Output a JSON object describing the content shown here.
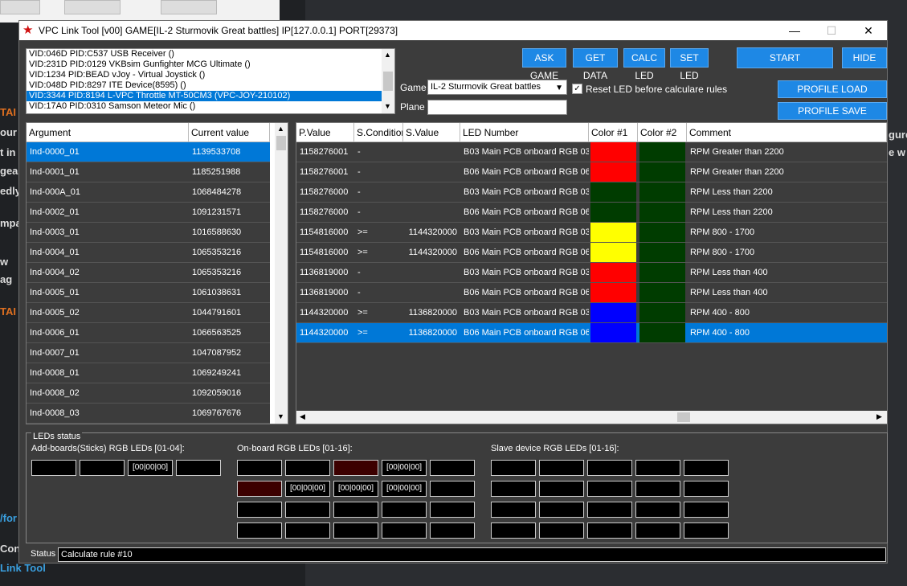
{
  "background": {
    "left_fragments": [
      "TAI",
      "our",
      "t in",
      "gea",
      "edly",
      "mpa",
      "w",
      "ag",
      "TAI",
      "/for",
      "Con"
    ],
    "right_fragments": [
      "gure",
      "e w"
    ],
    "bottom_link": "Link Tool"
  },
  "window": {
    "title": "VPC Link Tool [v00] GAME[IL-2 Sturmovik Great battles] IP[127.0.0.1] PORT[29373]",
    "controls": {
      "minimize": "—",
      "maximize": "☐",
      "close": "✕"
    }
  },
  "devices": {
    "items": [
      "VID:046D PID:C537 USB Receiver ()",
      "VID:231D PID:0129  VKBsim Gunfighter MCG Ultimate  ()",
      "VID:1234 PID:BEAD vJoy - Virtual Joystick ()",
      "VID:048D PID:8297 ITE Device(8595) ()",
      "VID:3344 PID:8194 L-VPC Throttle MT-50CM3 (VPC-JOY-210102)",
      "VID:17A0 PID:0310 Samson Meteor Mic ()"
    ],
    "selected_index": 4
  },
  "buttons": {
    "ask_game": "ASK GAME",
    "get_data": "GET DATA",
    "calc_led": "CALC LED",
    "set_led": "SET LED",
    "start": "START",
    "hide": "HIDE",
    "profile_load": "PROFILE LOAD",
    "profile_save": "PROFILE SAVE"
  },
  "form": {
    "game_label": "Game",
    "game_value": "IL-2 Sturmovik Great battles",
    "plane_label": "Plane",
    "plane_value": "",
    "reset_label": "Reset LED before calculare rules",
    "reset_checked": true
  },
  "args_table": {
    "headers": [
      "Argument",
      "Current value"
    ],
    "rows": [
      [
        "Ind-0000_01",
        "1139533708"
      ],
      [
        "Ind-0001_01",
        "1185251988"
      ],
      [
        "Ind-000A_01",
        "1068484278"
      ],
      [
        "Ind-0002_01",
        "1091231571"
      ],
      [
        "Ind-0003_01",
        "1016588630"
      ],
      [
        "Ind-0004_01",
        "1065353216"
      ],
      [
        "Ind-0004_02",
        "1065353216"
      ],
      [
        "Ind-0005_01",
        "1061038631"
      ],
      [
        "Ind-0005_02",
        "1044791601"
      ],
      [
        "Ind-0006_01",
        "1066563525"
      ],
      [
        "Ind-0007_01",
        "1047087952"
      ],
      [
        "Ind-0008_01",
        "1069249241"
      ],
      [
        "Ind-0008_02",
        "1092059016"
      ],
      [
        "Ind-0008_03",
        "1069767676"
      ]
    ],
    "selected_index": 0
  },
  "rules_table": {
    "headers": [
      "P.Value",
      "S.Condition",
      "S.Value",
      "LED Number",
      "Color #1",
      "Color #2",
      "Comment"
    ],
    "rows": [
      {
        "pvalue": "1158276001",
        "scond": "-",
        "svalue": "",
        "led": "B03 Main PCB onboard RGB 03",
        "color1": "#ff0000",
        "color2": "#003c00",
        "comment": "RPM Greater than 2200"
      },
      {
        "pvalue": "1158276001",
        "scond": "-",
        "svalue": "",
        "led": "B06 Main PCB onboard RGB 06",
        "color1": "#ff0000",
        "color2": "#003c00",
        "comment": "RPM Greater than 2200"
      },
      {
        "pvalue": "1158276000",
        "scond": "-",
        "svalue": "",
        "led": "B03 Main PCB onboard RGB 03",
        "color1": "#003c00",
        "color2": "#003c00",
        "comment": "RPM Less than 2200"
      },
      {
        "pvalue": "1158276000",
        "scond": "-",
        "svalue": "",
        "led": "B06 Main PCB onboard RGB 06",
        "color1": "#003c00",
        "color2": "#003c00",
        "comment": "RPM Less than 2200"
      },
      {
        "pvalue": "1154816000",
        "scond": ">=",
        "svalue": "1144320000",
        "led": "B03 Main PCB onboard RGB 03",
        "color1": "#ffff00",
        "color2": "#003c00",
        "comment": "RPM 800 - 1700"
      },
      {
        "pvalue": "1154816000",
        "scond": ">=",
        "svalue": "1144320000",
        "led": "B06 Main PCB onboard RGB 06",
        "color1": "#ffff00",
        "color2": "#003c00",
        "comment": "RPM 800 - 1700"
      },
      {
        "pvalue": "1136819000",
        "scond": "-",
        "svalue": "",
        "led": "B03 Main PCB onboard RGB 03",
        "color1": "#ff0000",
        "color2": "#003c00",
        "comment": "RPM Less than 400"
      },
      {
        "pvalue": "1136819000",
        "scond": "-",
        "svalue": "",
        "led": "B06 Main PCB onboard RGB 06",
        "color1": "#ff0000",
        "color2": "#003c00",
        "comment": "RPM Less than 400"
      },
      {
        "pvalue": "1144320000",
        "scond": ">=",
        "svalue": "1136820000",
        "led": "B03 Main PCB onboard RGB 03",
        "color1": "#0000ff",
        "color2": "#003c00",
        "comment": "RPM 400 - 800"
      },
      {
        "pvalue": "1144320000",
        "scond": ">=",
        "svalue": "1136820000",
        "led": "B06 Main PCB onboard RGB 06",
        "color1": "#0000ff",
        "color2": "#003c00",
        "comment": "RPM 400 - 800"
      }
    ],
    "selected_index": 9
  },
  "leds": {
    "group_title": "LEDs status",
    "addboards_label": "Add-boards(Sticks) RGB LEDs [01-04]:",
    "onboard_label": "On-board RGB LEDs [01-16]:",
    "slave_label": "Slave device RGB LEDs [01-16]:",
    "addboards": [
      {
        "text": "",
        "color": "#000000"
      },
      {
        "text": "",
        "color": "#000000"
      },
      {
        "text": "[00|00|00]",
        "color": "#000000"
      },
      {
        "text": "",
        "color": "#000000"
      }
    ],
    "onboard": [
      {
        "text": "",
        "color": "#000000"
      },
      {
        "text": "",
        "color": "#000000"
      },
      {
        "text": "",
        "color": "#3c0000"
      },
      {
        "text": "[00|00|00]",
        "color": "#000000"
      },
      {
        "text": "",
        "color": "#000000"
      },
      {
        "text": "",
        "color": "#3c0000"
      },
      {
        "text": "[00|00|00]",
        "color": "#000000"
      },
      {
        "text": "[00|00|00]",
        "color": "#000000"
      },
      {
        "text": "[00|00|00]",
        "color": "#000000"
      },
      {
        "text": "",
        "color": "#000000"
      },
      {
        "text": "",
        "color": "#000000"
      },
      {
        "text": "",
        "color": "#000000"
      },
      {
        "text": "",
        "color": "#000000"
      },
      {
        "text": "",
        "color": "#000000"
      },
      {
        "text": "",
        "color": "#000000"
      },
      {
        "text": "",
        "color": "#000000"
      },
      {
        "text": "",
        "color": "#000000"
      },
      {
        "text": "",
        "color": "#000000"
      },
      {
        "text": "",
        "color": "#000000"
      },
      {
        "text": "",
        "color": "#000000"
      }
    ],
    "slave": [
      {
        "text": "",
        "color": "#000000"
      },
      {
        "text": "",
        "color": "#000000"
      },
      {
        "text": "",
        "color": "#000000"
      },
      {
        "text": "",
        "color": "#000000"
      },
      {
        "text": "",
        "color": "#000000"
      },
      {
        "text": "",
        "color": "#000000"
      },
      {
        "text": "",
        "color": "#000000"
      },
      {
        "text": "",
        "color": "#000000"
      },
      {
        "text": "",
        "color": "#000000"
      },
      {
        "text": "",
        "color": "#000000"
      },
      {
        "text": "",
        "color": "#000000"
      },
      {
        "text": "",
        "color": "#000000"
      },
      {
        "text": "",
        "color": "#000000"
      },
      {
        "text": "",
        "color": "#000000"
      },
      {
        "text": "",
        "color": "#000000"
      },
      {
        "text": "",
        "color": "#000000"
      },
      {
        "text": "",
        "color": "#000000"
      },
      {
        "text": "",
        "color": "#000000"
      },
      {
        "text": "",
        "color": "#000000"
      },
      {
        "text": "",
        "color": "#000000"
      }
    ]
  },
  "status": {
    "label": "Status",
    "value": "Calculate rule #10"
  }
}
